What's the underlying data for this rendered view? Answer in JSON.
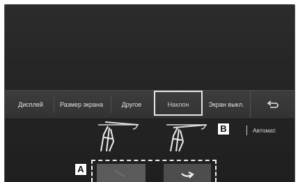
{
  "menu": {
    "items": [
      {
        "id": "display",
        "label": "Дисплей"
      },
      {
        "id": "screen-size",
        "label": "Размер экрана"
      },
      {
        "id": "other",
        "label": "Другое"
      },
      {
        "id": "tilt",
        "label": "Наклон",
        "selected": true
      },
      {
        "id": "screen-off",
        "label": "Экран выкл."
      }
    ],
    "back_icon": "back-arrow-icon"
  },
  "callouts": {
    "a": "A",
    "b": "B"
  },
  "auto_label": "Автомат.",
  "tilt_icons": [
    "screen-tilt-up-icon",
    "screen-tilt-down-icon"
  ],
  "tilt_buttons": [
    "tilt-down-arrow-icon",
    "tilt-up-arrow-icon"
  ],
  "colors": {
    "screen_bg": "#262626",
    "menu_bg": "#363636",
    "text": "#e2e2e2",
    "highlight": "#e6e6e6"
  }
}
